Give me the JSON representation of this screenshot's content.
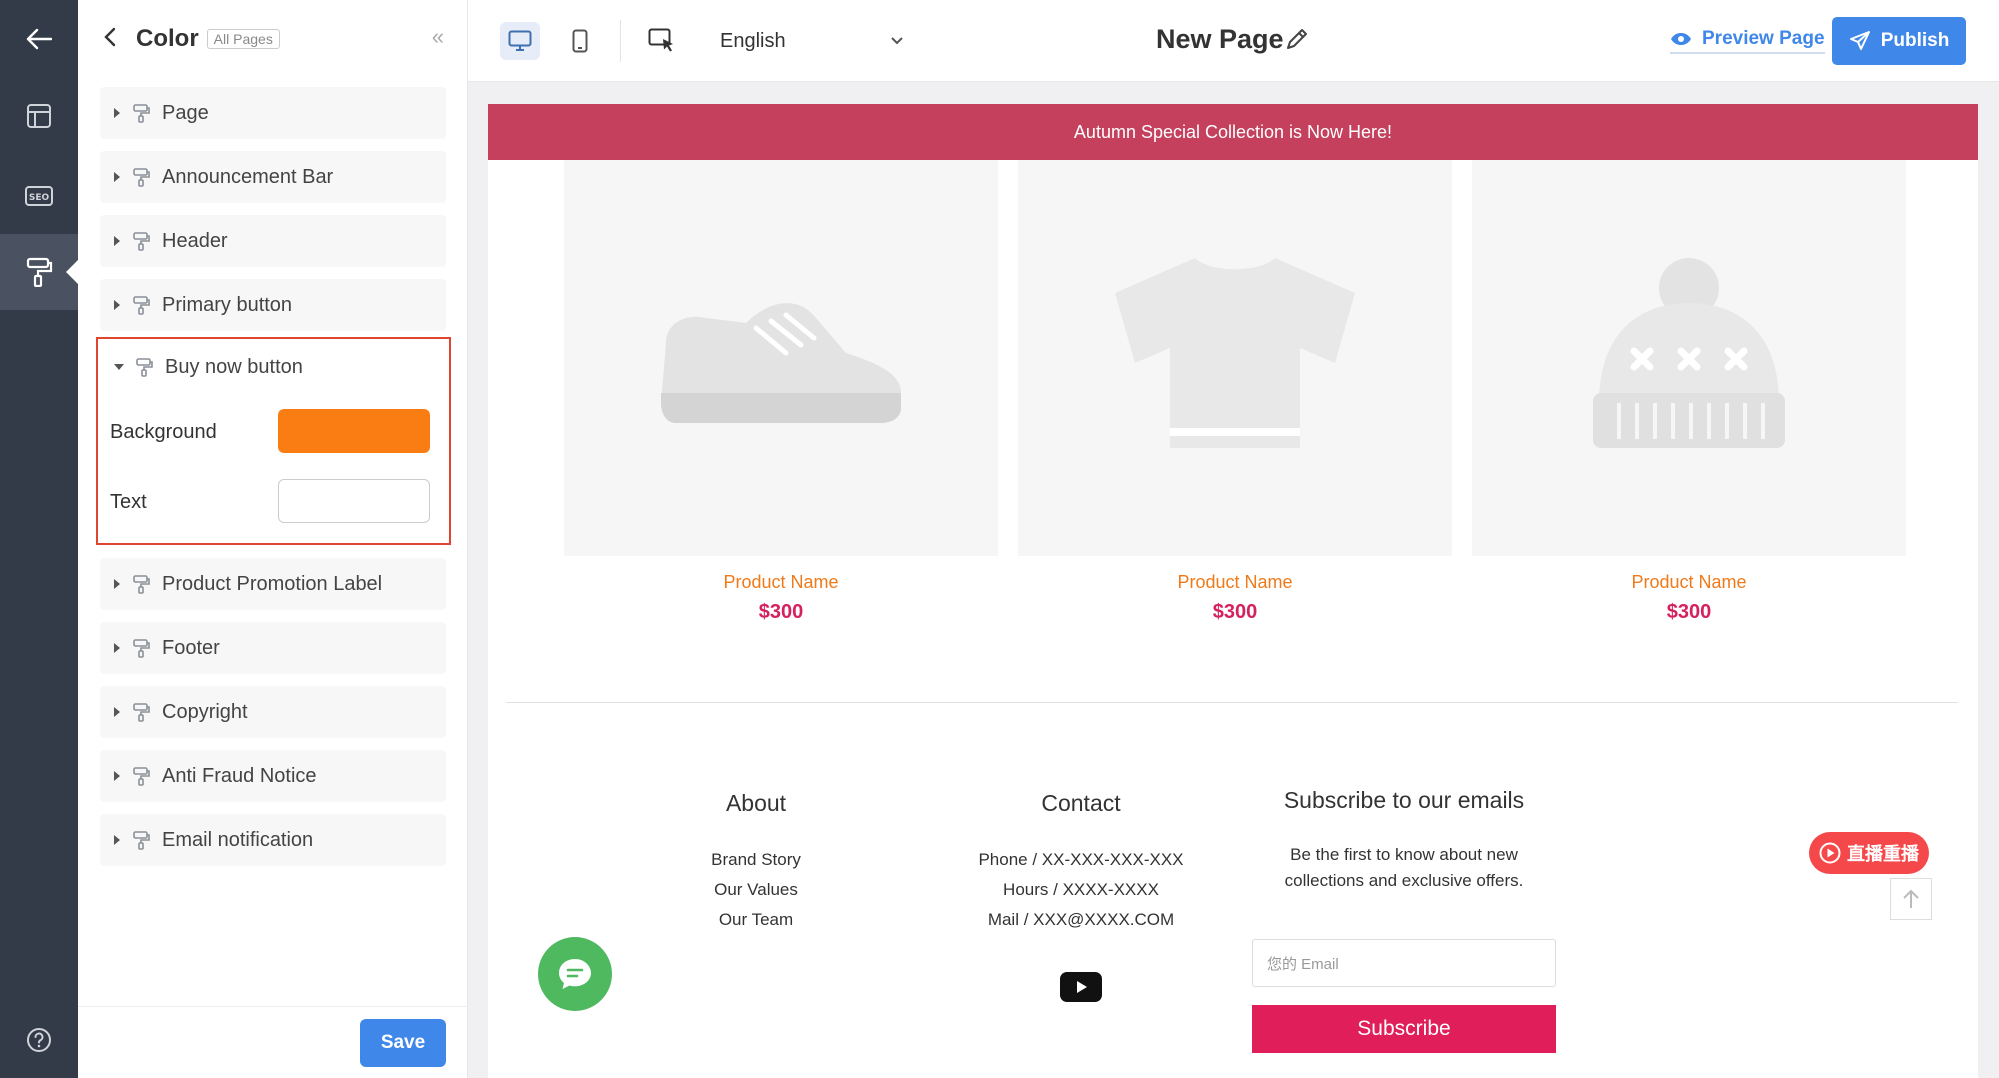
{
  "panel": {
    "title": "Color",
    "scope_badge": "All Pages",
    "categories_top": [
      "Page",
      "Announcement Bar",
      "Header",
      "Primary button"
    ],
    "expanded": {
      "label": "Buy now button",
      "background_label": "Background",
      "background_color": "#fa7d14",
      "text_label": "Text",
      "text_color": "#ffffff"
    },
    "categories_bottom": [
      "Product Promotion Label",
      "Footer",
      "Copyright",
      "Anti Fraud Notice",
      "Email notification"
    ],
    "save_label": "Save"
  },
  "topbar": {
    "language": "English",
    "page_title": "New Page",
    "preview_label": "Preview Page",
    "publish_label": "Publish"
  },
  "preview": {
    "announcement": "Autumn Special Collection is Now Here!",
    "products": [
      {
        "name": "Product Name",
        "price": "$300",
        "icon": "sneaker-icon"
      },
      {
        "name": "Product Name",
        "price": "$300",
        "icon": "tshirt-icon"
      },
      {
        "name": "Product Name",
        "price": "$300",
        "icon": "beanie-icon"
      }
    ],
    "footer": {
      "about_title": "About",
      "about_links": [
        "Brand Story",
        "Our Values",
        "Our Team"
      ],
      "contact_title": "Contact",
      "contact_lines": [
        "Phone / XX-XXX-XXX-XXX",
        "Hours / XXXX-XXXX",
        "Mail / XXX@XXXX.COM"
      ],
      "subscribe_title": "Subscribe to our emails",
      "subscribe_text_1": "Be the first to know about new",
      "subscribe_text_2": "collections and exclusive offers.",
      "email_placeholder": "您的 Email",
      "subscribe_label": "Subscribe"
    },
    "live_badge": "直播重播"
  },
  "colors": {
    "brand_blue": "#3f87e8",
    "announcement_bg": "#c4405c",
    "price": "#d6215f",
    "product_name": "#f07a1a",
    "subscribe_bg": "#e01e5a",
    "highlight_border": "#e0452f"
  }
}
